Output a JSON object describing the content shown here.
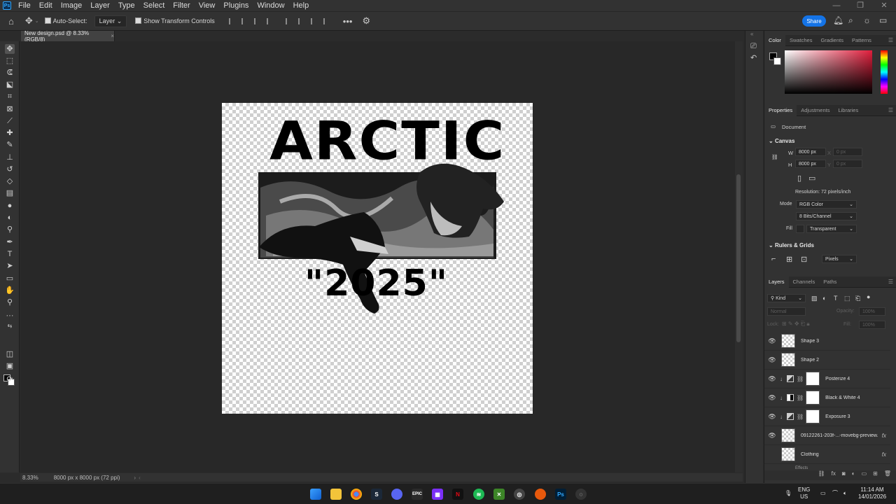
{
  "menu": [
    "File",
    "Edit",
    "Image",
    "Layer",
    "Type",
    "Select",
    "Filter",
    "View",
    "Plugins",
    "Window",
    "Help"
  ],
  "options": {
    "auto_select_label": "Auto-Select:",
    "auto_select_target": "Layer",
    "show_transform_label": "Show Transform Controls",
    "share_label": "Share"
  },
  "document": {
    "tab_title": "New design.psd @ 8.33% (RGB/8)",
    "zoom": "8.33%",
    "dimensions": "8000 px x 8000 px (72 ppi)"
  },
  "artwork": {
    "title": "ARCTIC",
    "year": "\"2025\""
  },
  "color_panel": {
    "tabs": [
      "Color",
      "Swatches",
      "Gradients",
      "Patterns"
    ]
  },
  "properties": {
    "tabs": [
      "Properties",
      "Adjustments",
      "Libraries"
    ],
    "type_label": "Document",
    "canvas_heading": "Canvas",
    "width_label": "W",
    "width_value": "8000 px",
    "height_label": "H",
    "height_value": "8000 px",
    "x_label": "X",
    "y_label": "Y",
    "x_placeholder": "0 px",
    "y_placeholder": "0 px",
    "resolution": "Resolution: 72 pixels/inch",
    "mode_label": "Mode",
    "mode_value": "RGB Color",
    "bits_value": "8 Bits/Channel",
    "fill_label": "Fill",
    "fill_value": "Transparent",
    "rulers_heading": "Rulers & Grids",
    "units_value": "Pixels"
  },
  "layers_panel": {
    "tabs": [
      "Layers",
      "Channels",
      "Paths"
    ],
    "kind_label": "Kind",
    "blend_mode": "Normal",
    "opacity_label": "Opacity:",
    "opacity_value": "100%",
    "lock_label": "Lock:",
    "fill_label": "Fill:",
    "fill_value": "100%",
    "layers": [
      {
        "name": "Shape 3",
        "kind": "smart",
        "visible": true
      },
      {
        "name": "Shape 2",
        "kind": "smart",
        "visible": true
      },
      {
        "name": "Posterize 4",
        "kind": "adjustment",
        "visible": true
      },
      {
        "name": "Black & White 4",
        "kind": "adjustment",
        "visible": true
      },
      {
        "name": "Exposure 3",
        "kind": "adjustment",
        "visible": true
      },
      {
        "name": "09122261-203f-...-movebg-preview...",
        "kind": "image",
        "visible": true,
        "fx": "fx"
      },
      {
        "name": "Clothing",
        "kind": "image",
        "visible": false,
        "fx": "fx"
      }
    ],
    "effects_label": "Effects"
  },
  "taskbar": {
    "lang_top": "ENG",
    "lang_bottom": "US",
    "time": "11:14 AM",
    "date": "14/01/2026"
  }
}
